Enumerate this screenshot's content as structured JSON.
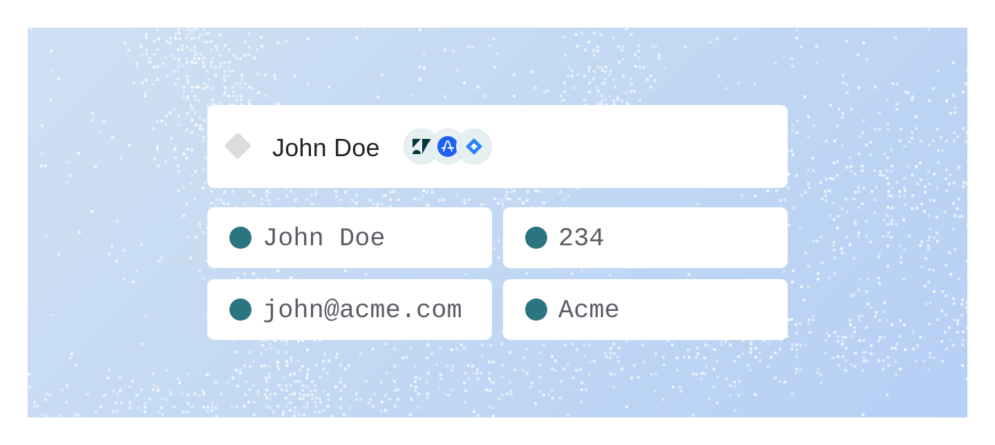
{
  "contact": {
    "name": "John Doe",
    "integrations": [
      {
        "icon": "zendesk-icon",
        "color": "#03363d"
      },
      {
        "icon": "amplitude-icon",
        "color": "#1e61f0"
      },
      {
        "icon": "jira-icon",
        "color": "#2684ff"
      }
    ]
  },
  "fields": [
    {
      "value": "John Doe"
    },
    {
      "value": "234"
    },
    {
      "value": "john@acme.com"
    },
    {
      "value": "Acme"
    }
  ],
  "colors": {
    "field_dot": "#2b7580",
    "placeholder_diamond": "#dcdcdc",
    "background": "#c3d9f3"
  }
}
